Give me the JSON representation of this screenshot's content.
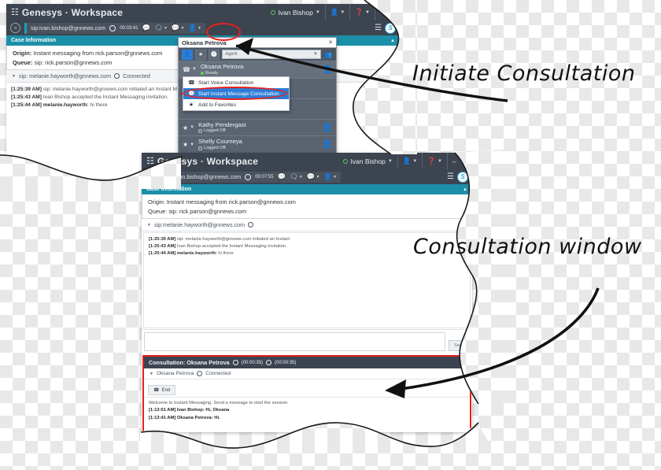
{
  "annotations": {
    "initiate": "Initiate Consultation",
    "consultation_window": "Consultation window"
  },
  "colors": {
    "titlebar": "#3c4450",
    "accent_teal": "#1b8fa8",
    "highlight_blue": "#2e7dd6",
    "annotation_red": "#e8201c",
    "status_green": "#5ddc5d"
  },
  "window1": {
    "titlebar": {
      "logo_icon": "genesys-logo-icon",
      "title": "Genesys  ·  Workspace",
      "user_name": "Ivan Bishop",
      "user_status_icon": "status-ready-icon",
      "agent_icon": "agent-icon",
      "help_icon": "help-icon",
      "minimize": "–",
      "maximize": "❐",
      "close": "✕"
    },
    "toolbar": {
      "close_icon": "end-interaction-icon",
      "party": "sip:ivan.bishop@gnnews.com",
      "timer": "00:03:41",
      "record_icon": "record-icon",
      "icons": [
        "im-reply-icon",
        "transfer-icon",
        "conference-icon",
        "consult-icon"
      ],
      "menu_icon": "main-menu-icon",
      "skype_icon": "skype-badge-icon"
    },
    "case_information": {
      "header": "Case Information",
      "collapse_icon": "chevron-up-icon",
      "origin_label": "Origin:",
      "origin_value": "Instant messaging from rick.parson@gnnews.com",
      "queue_label": "Queue:",
      "queue_value": "sip: rick.parson@gnnews.com"
    },
    "party": {
      "name": "sip: melanie.hayworth@gnnews.com",
      "status": "Connected",
      "status_icon": "connected-icon"
    },
    "chat_log": [
      {
        "time": "[1:25:39 AM]",
        "author": "sip: melanie.hayworth@gnnews.com",
        "text": " initiated an Instant M",
        "bold_author": false
      },
      {
        "time": "[1:25:43 AM]",
        "author": "Ivan Bishop",
        "text": " accepted the Instant Messaging invitation.",
        "bold_author": false
      },
      {
        "time": "[1:25:44 AM]",
        "author": "melanie.hayworth:",
        "text": " hi there",
        "bold_author": true
      }
    ]
  },
  "contact_popup": {
    "search_value": "Oksana Petrova",
    "close_icon": "close-icon",
    "buttons": [
      {
        "icon": "contact-list-icon",
        "active": true
      },
      {
        "icon": "favorites-star-icon",
        "active": false
      },
      {
        "icon": "recent-icon",
        "active": false
      }
    ],
    "filter_value": "Agent",
    "add_icon": "add-contact-icon",
    "contacts": [
      {
        "name": "Oksana Petrova",
        "status": "Ready",
        "status_type": "ready",
        "action_icon": "phone-icon"
      },
      {
        "name": "Kathy Pendergast",
        "status": "Logged Off",
        "status_type": "off",
        "action_icon": "star-icon"
      },
      {
        "name": "Shelly Courneya",
        "status": "Logged Off",
        "status_type": "off",
        "action_icon": "star-icon"
      }
    ],
    "context_menu": [
      {
        "label": "Start Voice Consultation",
        "icon": "phone-icon",
        "highlighted": false
      },
      {
        "label": "Start Instant Message Consultation",
        "icon": "im-icon",
        "highlighted": true
      },
      {
        "label": "Add to Favorites",
        "icon": "star-icon",
        "highlighted": false
      }
    ]
  },
  "window2": {
    "titlebar": {
      "logo_icon": "genesys-logo-icon",
      "title": "Genesys  ·  Workspace",
      "user_name": "Ivan Bishop",
      "agent_icon": "agent-icon",
      "help_icon": "help-icon"
    },
    "toolbar": {
      "party": "sip:ivan.bishop@gnnews.com",
      "timer": "00:07:55",
      "menu_icon": "main-menu-icon",
      "skype_icon": "skype-badge-icon"
    },
    "case_information": {
      "header": "Case Information",
      "origin_label": "Origin:",
      "origin_value": "Instant messaging from rick.parson@gnnews.com",
      "queue_label": "Queue:",
      "queue_value": "sip: rick.parson@gnnews.com"
    },
    "party": {
      "name": "sip:melanie.hayworth@gnnews.com",
      "status": "Connected"
    },
    "chat_log": [
      {
        "time": "[1:25:39 AM]",
        "author": "sip: melanie.hayworth@gnnews.com",
        "text": " initiated an Instant"
      },
      {
        "time": "[1:25:43 AM]",
        "author": "Ivan Bishop",
        "text": " accepted the Instant Messaging invitation."
      },
      {
        "time": "[1:25:44 AM]",
        "author": "melanie.hayworth:",
        "text": " hi there"
      }
    ],
    "composer": {
      "value": "",
      "send_label": "Send"
    },
    "consultation": {
      "header": "Consultation: Oksana Petrova",
      "timer1": "(00:00:35)",
      "timer2": "(00:00:35)",
      "party_name": "Oksana Petrova",
      "party_status": "Connected",
      "end_label": "End",
      "end_icon": "end-call-icon",
      "welcome": "Welcome to Instant Messaging. Send a message to start the session.",
      "messages": [
        {
          "time": "[1:13:51 AM]",
          "author": "Ivan Bishop:",
          "text": " Hi, Oksana"
        },
        {
          "time": "[1:13:41 AM]",
          "author": "Oksana Petrova:",
          "text": " Hi."
        }
      ]
    }
  }
}
